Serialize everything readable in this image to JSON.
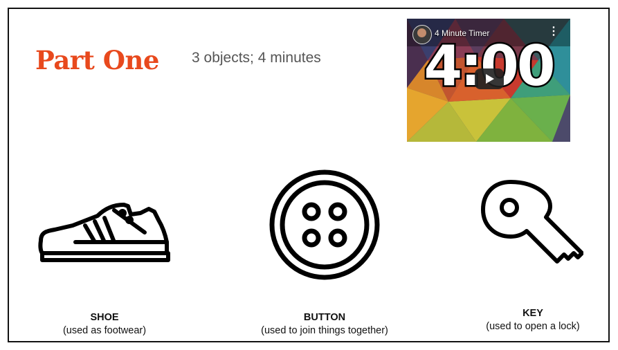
{
  "slide": {
    "title": "Part One",
    "title_color": "#e8491d",
    "subtitle": "3 objects; 4 minutes"
  },
  "video": {
    "title": "4 Minute Timer",
    "timer": "4:00",
    "menu_icon": "more-vert-icon",
    "play_icon": "youtube-play-icon"
  },
  "objects": [
    {
      "name": "SHOE",
      "desc": "(used as footwear)",
      "icon": "shoe-icon"
    },
    {
      "name": "BUTTON",
      "desc": "(used to join things together)",
      "icon": "button-icon"
    },
    {
      "name": "KEY",
      "desc": "(used to open a lock)",
      "icon": "key-icon"
    }
  ]
}
